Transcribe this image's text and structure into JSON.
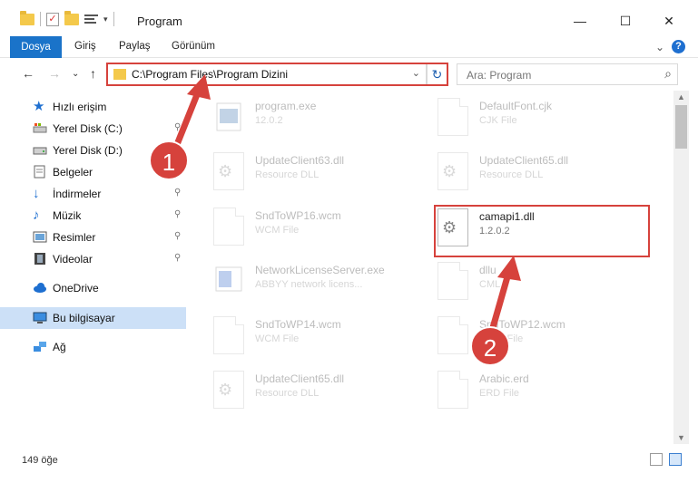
{
  "window": {
    "title": "Program",
    "minimize": "—",
    "maximize": "☐",
    "close": "✕"
  },
  "ribbon": {
    "file_tab": "Dosya",
    "tabs": [
      "Giriş",
      "Paylaş",
      "Görünüm"
    ],
    "expand": "⌄",
    "help": "?"
  },
  "address_bar": {
    "back": "←",
    "forward": "→",
    "recent": "⌄",
    "up": "↑",
    "path": "C:\\Program Files\\Program Dizini",
    "dropdown": "⌄",
    "refresh": "↻",
    "search_placeholder": "Ara: Program",
    "search_icon": "⌕"
  },
  "sidebar": {
    "items": [
      {
        "label": "Hızlı erişim",
        "icon": "star-icon",
        "pinned": false
      },
      {
        "label": "Yerel Disk (C:)",
        "icon": "drive-icon",
        "pinned": true
      },
      {
        "label": "Yerel Disk (D:)",
        "icon": "drive-icon",
        "pinned": true
      },
      {
        "label": "Belgeler",
        "icon": "documents-icon",
        "pinned": true
      },
      {
        "label": "İndirmeler",
        "icon": "download-icon",
        "pinned": true
      },
      {
        "label": "Müzik",
        "icon": "music-icon",
        "pinned": true
      },
      {
        "label": "Resimler",
        "icon": "pictures-icon",
        "pinned": true
      },
      {
        "label": "Videolar",
        "icon": "video-icon",
        "pinned": true
      },
      {
        "label": "OneDrive",
        "icon": "cloud-icon",
        "pinned": false
      },
      {
        "label": "Bu bilgisayar",
        "icon": "computer-icon",
        "pinned": false
      },
      {
        "label": "Ağ",
        "icon": "network-icon",
        "pinned": false
      }
    ],
    "pin_glyph": "📌"
  },
  "files": [
    {
      "name": "program.exe",
      "sub": "12.0.2",
      "icon": "exe-icon",
      "faded": true
    },
    {
      "name": "DefaultFont.cjk",
      "sub": "CJK File",
      "icon": "document-icon",
      "faded": true
    },
    {
      "name": "UpdateClient63.dll",
      "sub": "Resource DLL",
      "icon": "dll-icon",
      "faded": true
    },
    {
      "name": "UpdateClient65.dll",
      "sub": "Resource DLL",
      "icon": "dll-icon",
      "faded": true
    },
    {
      "name": "SndToWP16.wcm",
      "sub": "WCM File",
      "icon": "document-icon",
      "faded": true
    },
    {
      "name": "camapi1.dll",
      "sub": "1.2.0.2",
      "icon": "dll-icon",
      "faded": false
    },
    {
      "name": "NetworkLicenseServer.exe",
      "sub": "ABBYY network licens...",
      "icon": "exe-icon",
      "faded": true
    },
    {
      "name": "dllu",
      "sub": "CML",
      "icon": "document-icon",
      "faded": true
    },
    {
      "name": "SndToWP14.wcm",
      "sub": "WCM File",
      "icon": "document-icon",
      "faded": true
    },
    {
      "name": "SndToWP12.wcm",
      "sub": "WCM File",
      "icon": "document-icon",
      "faded": true
    },
    {
      "name": "UpdateClient65.dll",
      "sub": "Resource DLL",
      "icon": "dll-icon",
      "faded": true
    },
    {
      "name": "Arabic.erd",
      "sub": "ERD File",
      "icon": "document-icon",
      "faded": true
    }
  ],
  "status": {
    "count": "149 öğe"
  },
  "annotations": {
    "badge1": "1",
    "badge2": "2",
    "accent": "#d6423c"
  }
}
